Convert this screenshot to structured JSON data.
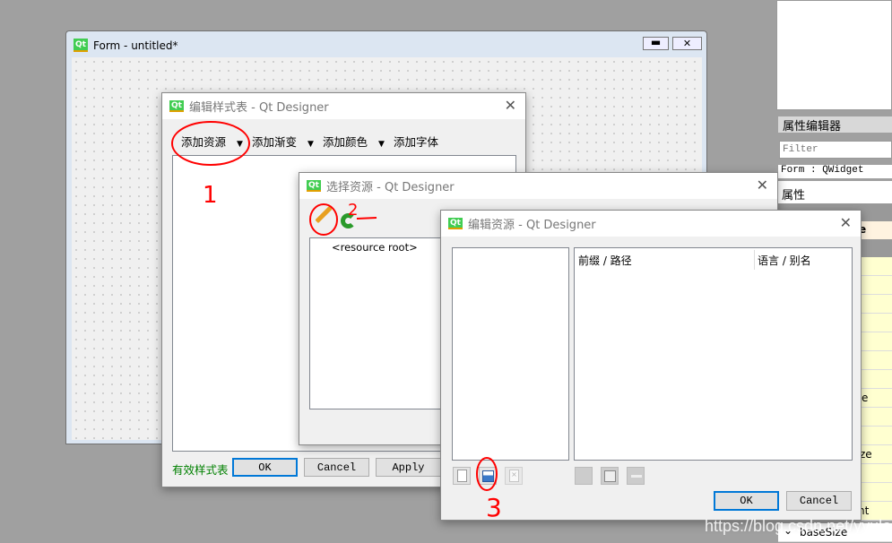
{
  "form_window": {
    "title": "Form - untitled*"
  },
  "property_editor": {
    "title": "属性编辑器",
    "filter_placeholder": "Filter",
    "object": "Form : QWidget",
    "column": "属性",
    "rows_partial": [
      "e",
      "e",
      "ze",
      "nt"
    ],
    "last_row": "baseSize"
  },
  "stylesheet_dialog": {
    "title": "编辑样式表 - Qt Designer",
    "toolbar": [
      "添加资源",
      "添加渐变",
      "添加颜色",
      "添加字体"
    ],
    "status": "有效样式表",
    "ok": "OK",
    "cancel": "Cancel",
    "apply": "Apply",
    "status_color": "#008000"
  },
  "select_resource_dialog": {
    "title": "选择资源 - Qt Designer",
    "tree_root": "<resource root>"
  },
  "edit_resource_dialog": {
    "title": "编辑资源 - Qt Designer",
    "columns": [
      "前缀 / 路径",
      "语言 / 别名"
    ],
    "ok": "OK",
    "cancel": "Cancel"
  },
  "annotations": [
    "1",
    "2",
    "3"
  ],
  "watermark": "https://blog.csdn.net/yyulong"
}
